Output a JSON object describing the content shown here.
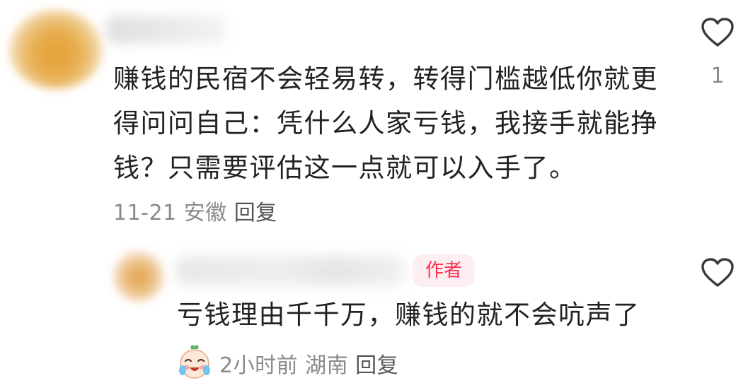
{
  "comment": {
    "text": "赚钱的民宿不会轻易转，转得门槛越低你就更得问问自己：凭什么人家亏钱，我接手就能挣钱？只需要评估这一点就可以入手了。",
    "date": "11-21",
    "location": "安徽",
    "reply_label": "回复",
    "like_count": "1"
  },
  "reply": {
    "badge": "作者",
    "text": "亏钱理由千千万，赚钱的就不会吭声了",
    "time": "2小时前",
    "location": "湖南",
    "reply_label": "回复"
  },
  "colors": {
    "badge_text": "#ff2e4d",
    "badge_bg": "#fdeff1",
    "meta_text": "#8a8a8a"
  },
  "icons": {
    "like": "heart-outline-icon",
    "emoji": "crying-laughing-emoji-icon"
  }
}
